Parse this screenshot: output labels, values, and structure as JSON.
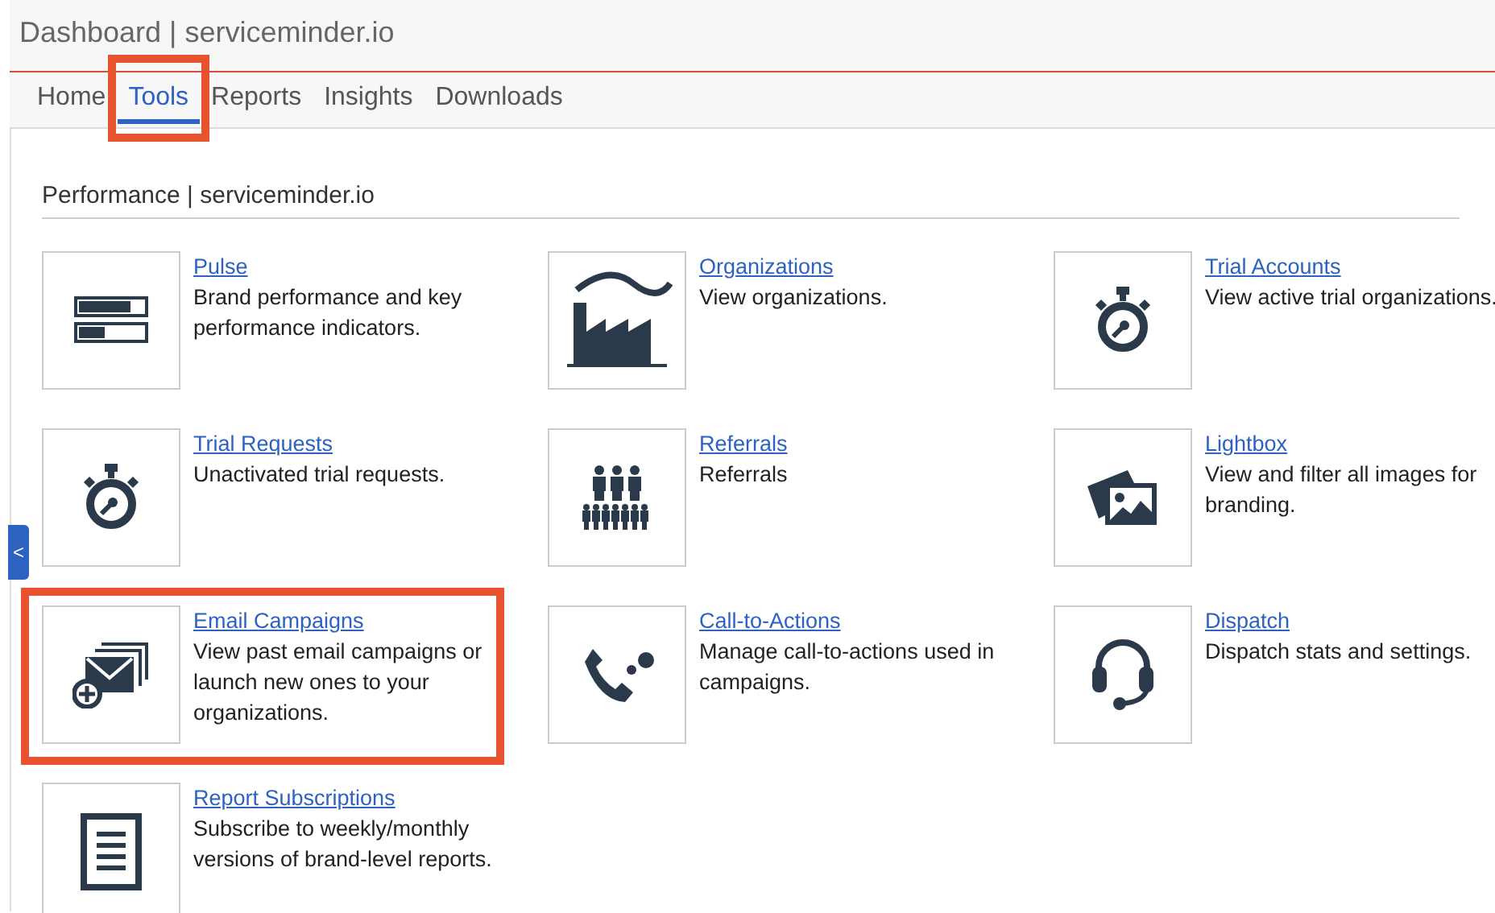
{
  "window": {
    "title": "Dashboard | serviceminder.io"
  },
  "tabs": [
    {
      "label": "Home",
      "selected": false,
      "highlighted": false
    },
    {
      "label": "Tools",
      "selected": true,
      "highlighted": true
    },
    {
      "label": "Reports",
      "selected": false,
      "highlighted": false
    },
    {
      "label": "Insights",
      "selected": false,
      "highlighted": false
    },
    {
      "label": "Downloads",
      "selected": false,
      "highlighted": false
    }
  ],
  "sidebar_toggle": {
    "label": "<"
  },
  "section": {
    "title": "Performance | serviceminder.io"
  },
  "tools": [
    {
      "kind": "bars",
      "title": "Pulse",
      "description": "Brand performance and key performance indicators.",
      "highlighted": false
    },
    {
      "kind": "factory",
      "title": "Organizations",
      "description": "View organizations.",
      "highlighted": false
    },
    {
      "kind": "stopwatch",
      "title": "Trial Accounts",
      "description": "View active trial organizations.",
      "highlighted": false
    },
    {
      "kind": "stopwatch",
      "title": "Trial Requests",
      "description": "Unactivated trial requests.",
      "highlighted": false
    },
    {
      "kind": "people",
      "title": "Referrals",
      "description": "Referrals",
      "highlighted": false
    },
    {
      "kind": "photos",
      "title": "Lightbox",
      "description": "View and filter all images for branding.",
      "highlighted": false
    },
    {
      "kind": "email",
      "title": "Email Campaigns",
      "description": "View past email campaigns or launch new ones to your organizations.",
      "highlighted": true
    },
    {
      "kind": "phone",
      "title": "Call-to-Actions",
      "description": "Manage call-to-actions used in campaigns.",
      "highlighted": false
    },
    {
      "kind": "headset",
      "title": "Dispatch",
      "description": "Dispatch stats and settings.",
      "highlighted": false
    },
    {
      "kind": "document",
      "title": "Report Subscriptions",
      "description": "Subscribe to weekly/monthly versions of brand-level reports.",
      "highlighted": false
    }
  ]
}
